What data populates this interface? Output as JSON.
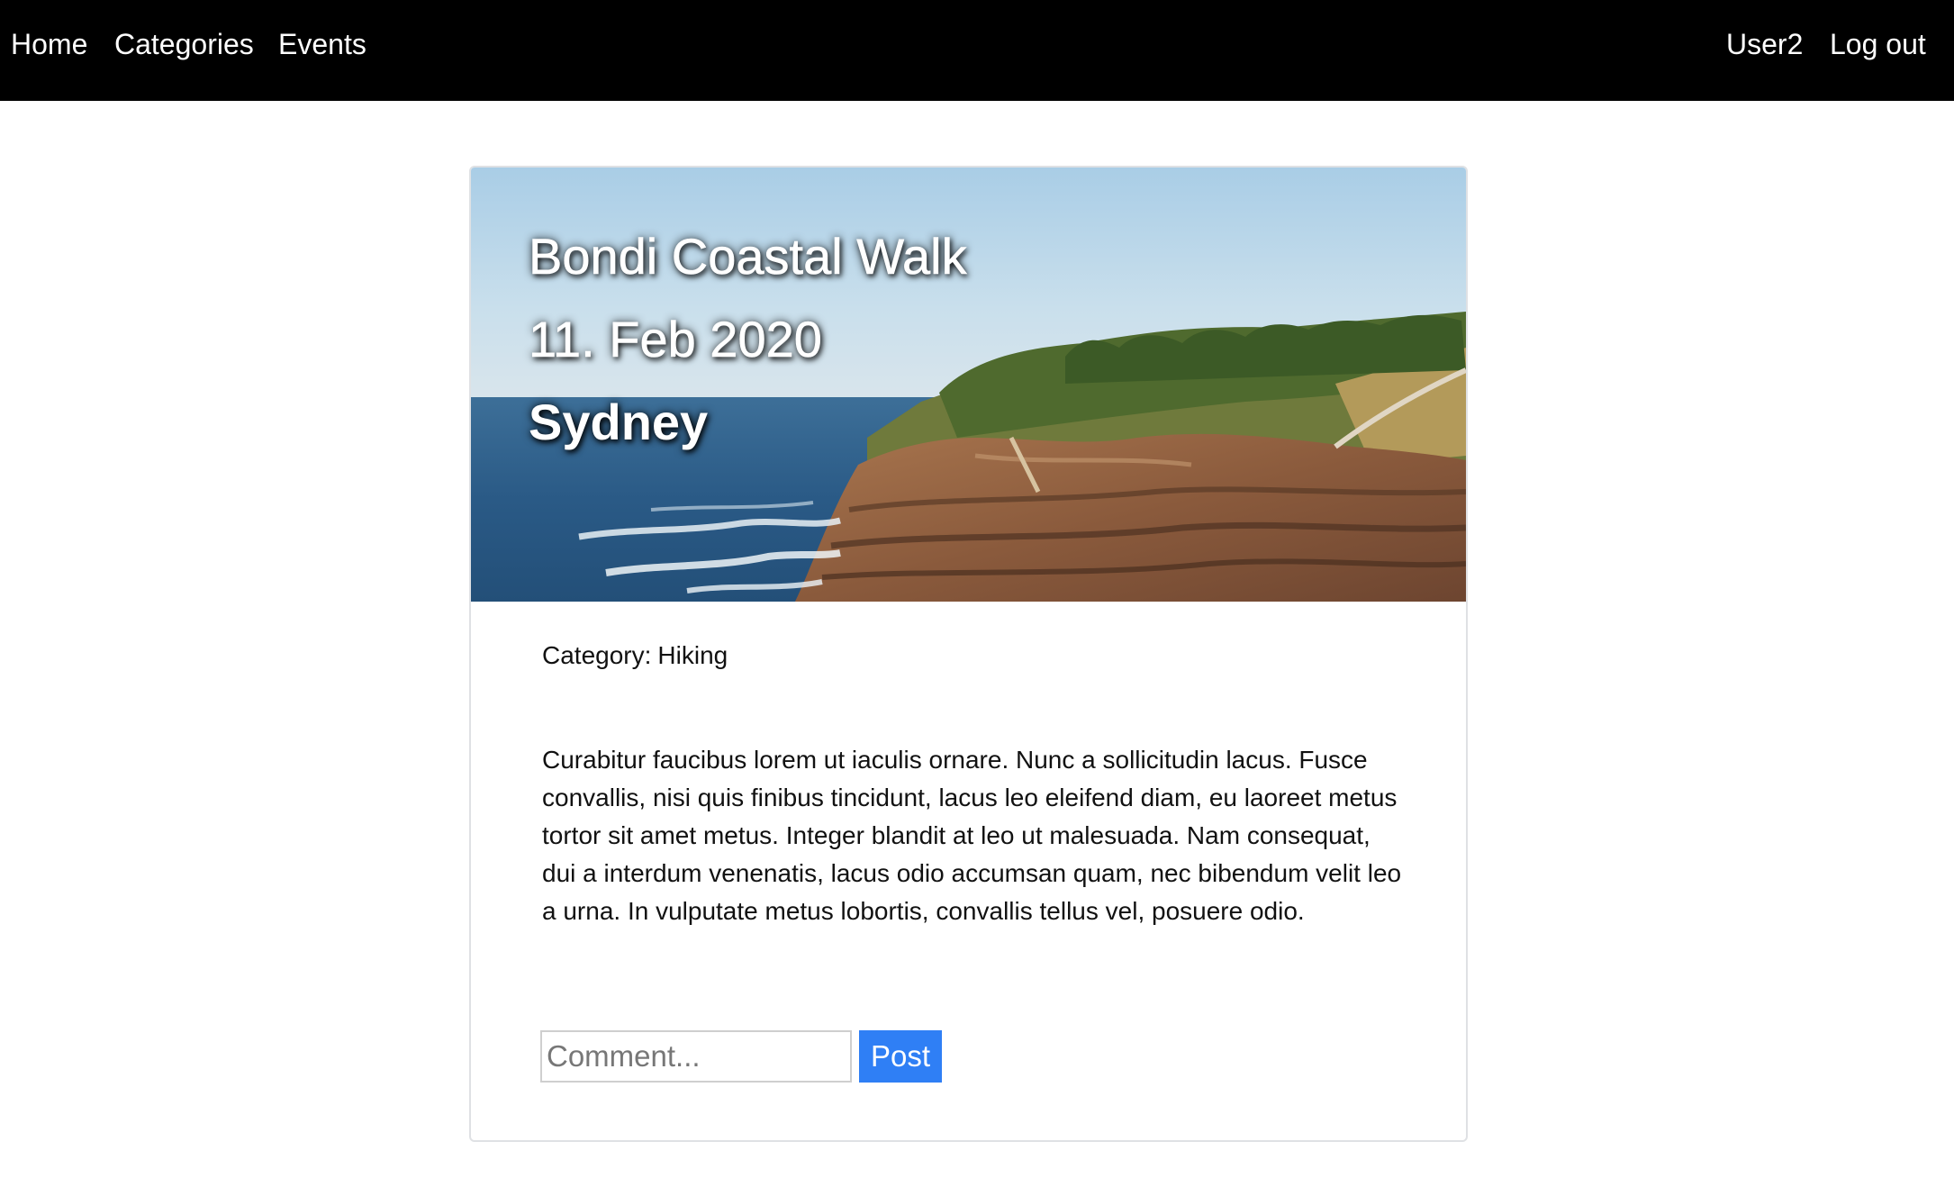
{
  "nav": {
    "home": "Home",
    "categories": "Categories",
    "events": "Events",
    "user": "User2",
    "logout": "Log out"
  },
  "event": {
    "title": "Bondi Coastal Walk",
    "date": "11. Feb 2020",
    "city": "Sydney",
    "category_label": "Category:",
    "category_value": "Hiking",
    "description": "Curabitur faucibus lorem ut iaculis ornare. Nunc a sollicitudin lacus. Fusce convallis, nisi quis finibus tincidunt, lacus leo eleifend diam, eu laoreet metus tortor sit amet metus. Integer blandit at leo ut malesuada. Nam consequat, dui a interdum venenatis, lacus odio accumsan quam, nec bibendum velit leo a urna. In vulputate metus lobortis, convallis tellus vel, posuere odio."
  },
  "comment": {
    "placeholder": "Comment...",
    "post_label": "Post"
  },
  "colors": {
    "navbar": "#000000",
    "button": "#2f7ff5",
    "card_border": "#dfe1e4"
  }
}
